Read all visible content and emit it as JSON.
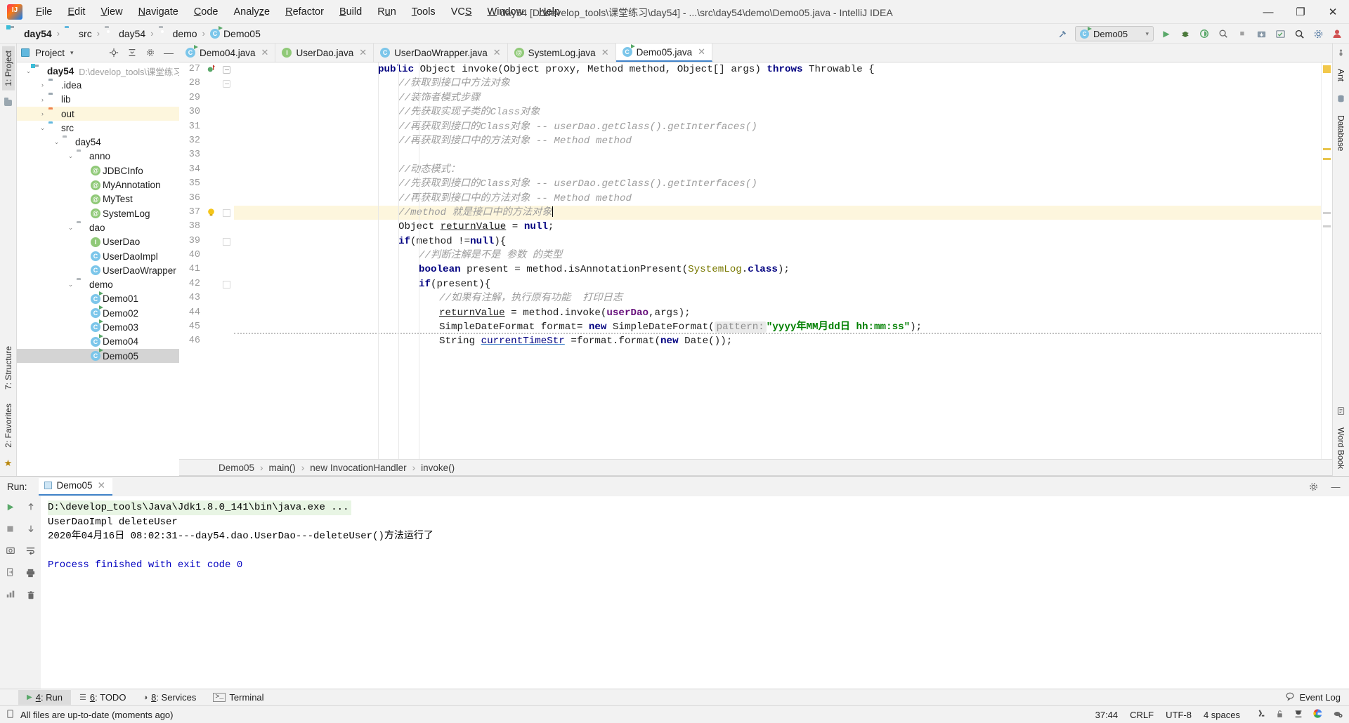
{
  "window": {
    "title": "day54 [D:\\develop_tools\\课堂练习\\day54] - ...\\src\\day54\\demo\\Demo05.java - IntelliJ IDEA",
    "minimize": "—",
    "maximize": "❐",
    "close": "✕"
  },
  "menu": [
    {
      "label": "File"
    },
    {
      "label": "Edit"
    },
    {
      "label": "View"
    },
    {
      "label": "Navigate"
    },
    {
      "label": "Code"
    },
    {
      "label": "Analyze"
    },
    {
      "label": "Refactor"
    },
    {
      "label": "Build"
    },
    {
      "label": "Run"
    },
    {
      "label": "Tools"
    },
    {
      "label": "VCS"
    },
    {
      "label": "Window"
    },
    {
      "label": "Help"
    }
  ],
  "breadcrumb": {
    "items": [
      {
        "label": "day54",
        "icon": "module-icon"
      },
      {
        "label": "src",
        "icon": "source-folder-icon"
      },
      {
        "label": "day54",
        "icon": "package-icon"
      },
      {
        "label": "demo",
        "icon": "package-icon"
      },
      {
        "label": "Demo05",
        "icon": "class-icon"
      }
    ],
    "separator": "›"
  },
  "navbar_right": {
    "hammer_icon": "build-icon",
    "run_config": "Demo05",
    "run_icon": "▶",
    "debug_icon": "debug-icon",
    "run_coverage_icon": "run-with-coverage-icon",
    "profiler_icon": "profiler-icon",
    "stop_icon": "■",
    "update_icon": "update-project-icon",
    "commit_icon": "commit-icon",
    "search_icon": "🔍",
    "settings_icon": "settings-icon",
    "account_icon": "account-icon"
  },
  "rails": {
    "left_top": "1: Project",
    "left_bottom_1": "7: Structure",
    "left_bottom_2": "2: Favorites",
    "right_top_1": "Ant",
    "right_top_2": "Database",
    "right_bottom": "Word Book"
  },
  "project_tool": {
    "title": "Project",
    "chevron": "▾",
    "locate_icon": "locate-icon",
    "collapse_icon": "collapse-all-icon",
    "settings_icon": "gear-icon",
    "hide_icon": "hide-icon",
    "tree": [
      {
        "depth": 0,
        "arrow": "⌄",
        "icon": "module-icon",
        "label": "day54",
        "bold": true,
        "path": "D:\\develop_tools\\课堂练习",
        "state": "normal"
      },
      {
        "depth": 1,
        "arrow": "›",
        "icon": "folder-icon",
        "label": ".idea",
        "bold": false,
        "path": "",
        "state": "normal"
      },
      {
        "depth": 1,
        "arrow": "›",
        "icon": "folder-icon",
        "label": "lib",
        "bold": false,
        "path": "",
        "state": "normal"
      },
      {
        "depth": 1,
        "arrow": "›",
        "icon": "folder-orange-icon",
        "label": "out",
        "bold": false,
        "path": "",
        "state": "highlight"
      },
      {
        "depth": 1,
        "arrow": "⌄",
        "icon": "folder-blue-icon",
        "label": "src",
        "bold": false,
        "path": "",
        "state": "normal"
      },
      {
        "depth": 2,
        "arrow": "⌄",
        "icon": "package-icon",
        "label": "day54",
        "bold": false,
        "path": "",
        "state": "normal"
      },
      {
        "depth": 3,
        "arrow": "⌄",
        "icon": "package-icon",
        "label": "anno",
        "bold": false,
        "path": "",
        "state": "normal"
      },
      {
        "depth": 4,
        "arrow": "",
        "icon": "annotation-icon",
        "label": "JDBCInfo",
        "bold": false,
        "path": "",
        "state": "normal"
      },
      {
        "depth": 4,
        "arrow": "",
        "icon": "annotation-icon",
        "label": "MyAnnotation",
        "bold": false,
        "path": "",
        "state": "normal"
      },
      {
        "depth": 4,
        "arrow": "",
        "icon": "annotation-icon",
        "label": "MyTest",
        "bold": false,
        "path": "",
        "state": "normal"
      },
      {
        "depth": 4,
        "arrow": "",
        "icon": "annotation-icon",
        "label": "SystemLog",
        "bold": false,
        "path": "",
        "state": "normal"
      },
      {
        "depth": 3,
        "arrow": "⌄",
        "icon": "package-icon",
        "label": "dao",
        "bold": false,
        "path": "",
        "state": "normal"
      },
      {
        "depth": 4,
        "arrow": "",
        "icon": "interface-icon",
        "label": "UserDao",
        "bold": false,
        "path": "",
        "state": "normal"
      },
      {
        "depth": 4,
        "arrow": "",
        "icon": "class-icon",
        "label": "UserDaoImpl",
        "bold": false,
        "path": "",
        "state": "normal"
      },
      {
        "depth": 4,
        "arrow": "",
        "icon": "class-icon",
        "label": "UserDaoWrapper",
        "bold": false,
        "path": "",
        "state": "normal"
      },
      {
        "depth": 3,
        "arrow": "⌄",
        "icon": "package-icon",
        "label": "demo",
        "bold": false,
        "path": "",
        "state": "normal"
      },
      {
        "depth": 4,
        "arrow": "",
        "icon": "runnable-class-icon",
        "label": "Demo01",
        "bold": false,
        "path": "",
        "state": "normal"
      },
      {
        "depth": 4,
        "arrow": "",
        "icon": "runnable-class-icon",
        "label": "Demo02",
        "bold": false,
        "path": "",
        "state": "normal"
      },
      {
        "depth": 4,
        "arrow": "",
        "icon": "runnable-class-icon",
        "label": "Demo03",
        "bold": false,
        "path": "",
        "state": "normal"
      },
      {
        "depth": 4,
        "arrow": "",
        "icon": "runnable-class-icon",
        "label": "Demo04",
        "bold": false,
        "path": "",
        "state": "normal"
      },
      {
        "depth": 4,
        "arrow": "",
        "icon": "runnable-class-icon",
        "label": "Demo05",
        "bold": false,
        "path": "",
        "state": "selected"
      }
    ]
  },
  "editor": {
    "tabs": [
      {
        "label": "Demo04.java",
        "icon": "runnable-class-icon",
        "active": false
      },
      {
        "label": "UserDao.java",
        "icon": "interface-icon",
        "active": false
      },
      {
        "label": "UserDaoWrapper.java",
        "icon": "class-icon",
        "active": false
      },
      {
        "label": "SystemLog.java",
        "icon": "annotation-icon",
        "active": false
      },
      {
        "label": "Demo05.java",
        "icon": "runnable-class-icon",
        "active": true
      }
    ],
    "first_line": 27,
    "lines": [
      {
        "no": 27,
        "indent": 0
      },
      {
        "no": 28,
        "indent": 0
      },
      {
        "no": 29,
        "indent": 0
      },
      {
        "no": 30,
        "indent": 0
      },
      {
        "no": 31,
        "indent": 0
      },
      {
        "no": 32,
        "indent": 0
      },
      {
        "no": 33,
        "indent": 0
      },
      {
        "no": 34,
        "indent": 0
      },
      {
        "no": 35,
        "indent": 0
      },
      {
        "no": 36,
        "indent": 0
      },
      {
        "no": 37,
        "indent": 0
      },
      {
        "no": 38,
        "indent": 0
      },
      {
        "no": 39,
        "indent": 0
      },
      {
        "no": 40,
        "indent": 0
      },
      {
        "no": 41,
        "indent": 0
      },
      {
        "no": 42,
        "indent": 0
      },
      {
        "no": 43,
        "indent": 0
      },
      {
        "no": 44,
        "indent": 0
      },
      {
        "no": 45,
        "indent": 0
      },
      {
        "no": 46,
        "indent": 0
      }
    ],
    "code_text": {
      "l27_a": "public",
      "l27_b": " Object invoke(Object proxy, Method method, Object[] args) ",
      "l27_c": "throws",
      "l27_d": " Throwable {",
      "l28": "//获取到接口中方法对象",
      "l29": "//装饰者模式步骤",
      "l30": "//先获取实现子类的Class对象",
      "l31": "//再获取到接口的Class对象 -- userDao.getClass().getInterfaces()",
      "l32": "//再获取到接口中的方法对象 -- Method method",
      "l34": "//动态模式：",
      "l35": "//先获取到接口的Class对象 -- userDao.getClass().getInterfaces()",
      "l36": "//再获取到接口中的方法对象 -- Method method",
      "l37": "//method 就是接口中的方法对象",
      "l38_a": "Object ",
      "l38_b": "returnValue",
      "l38_c": " = ",
      "l38_d": "null",
      "l38_e": ";",
      "l39_a": "if",
      "l39_b": "(method !=",
      "l39_c": "null",
      "l39_d": "){",
      "l40": "//判断注解是不是 参数 的类型",
      "l41_a": "boolean",
      "l41_b": " present = method.isAnnotationPresent(",
      "l41_c": "SystemLog",
      "l41_d": ".",
      "l41_e": "class",
      "l41_f": ");",
      "l42_a": "if",
      "l42_b": "(present){",
      "l43": "//如果有注解，执行原有功能  打印日志",
      "l44_a": "returnValue",
      "l44_b": " = method.invoke(",
      "l44_c": "userDao",
      "l44_d": ",args);",
      "l45_a": "SimpleDateFormat format= ",
      "l45_b": "new",
      "l45_c": " SimpleDateFormat(",
      "l45_hint": "pattern:",
      "l45_d": "\"yyyy年MM月dd日 hh:mm:ss\"",
      "l45_e": ");",
      "l46_a": "String ",
      "l46_b": "currentTimeStr",
      "l46_c": " =format.format(",
      "l46_d": "new",
      "l46_e": " Date());"
    },
    "bottom_breadcrumb": [
      "Demo05",
      "main()",
      "new InvocationHandler",
      "invoke()"
    ],
    "bottom_breadcrumb_sep": "›"
  },
  "run_panel": {
    "label": "Run:",
    "tab_label": "Demo05",
    "tab_close": "✕",
    "settings_icon": "gear-icon",
    "hide_icon": "—",
    "toolbar": [
      "rerun-icon",
      "up-icon",
      "stop-icon",
      "down-icon",
      "screenshot-icon",
      "soft-wrap-icon",
      "export-icon",
      "print-icon",
      "scroll-end-icon",
      "trash-icon"
    ],
    "console": [
      {
        "text": "D:\\develop_tools\\Java\\Jdk1.8.0_141\\bin\\java.exe ...",
        "style": "cmd"
      },
      {
        "text": "UserDaoImpl deleteUser",
        "style": "plain"
      },
      {
        "text": "2020年04月16日 08:02:31---day54.dao.UserDao---deleteUser()方法运行了",
        "style": "plain"
      },
      {
        "text": "",
        "style": "plain"
      },
      {
        "text": "Process finished with exit code 0",
        "style": "blue"
      }
    ]
  },
  "toolwindow_bar": {
    "items": [
      {
        "num": "4",
        "label": ": Run",
        "icon": "run-icon",
        "active": true
      },
      {
        "num": "6",
        "label": ": TODO",
        "icon": "todo-icon",
        "active": false
      },
      {
        "num": "8",
        "label": ": Services",
        "icon": "services-icon",
        "active": false
      },
      {
        "num": "",
        "label": "Terminal",
        "icon": "terminal-icon",
        "active": false
      }
    ],
    "event_log": "Event Log",
    "event_log_icon": "balloon-icon"
  },
  "statusbar": {
    "message": "All files are up-to-date (moments ago)",
    "message_icon": "document-icon",
    "caret_position": "37:44",
    "line_separator": "CRLF",
    "encoding": "UTF-8",
    "indent": "4 spaces",
    "icons": [
      "git-branch-icon",
      "lock-icon",
      "inspector-icon",
      "google-icon",
      "settings-cloud-icon"
    ]
  },
  "colors": {
    "accent": "#4083c9",
    "highlight_line": "#fdf6dd",
    "keyword": "#000080",
    "comment": "#9d9d9d",
    "string": "#008000",
    "field": "#660e7a",
    "class_ref": "#787800",
    "console_cmd_bg": "#e8f5e4",
    "console_blue": "#0000c0",
    "titlebar_bg": "#f2f2f2"
  }
}
